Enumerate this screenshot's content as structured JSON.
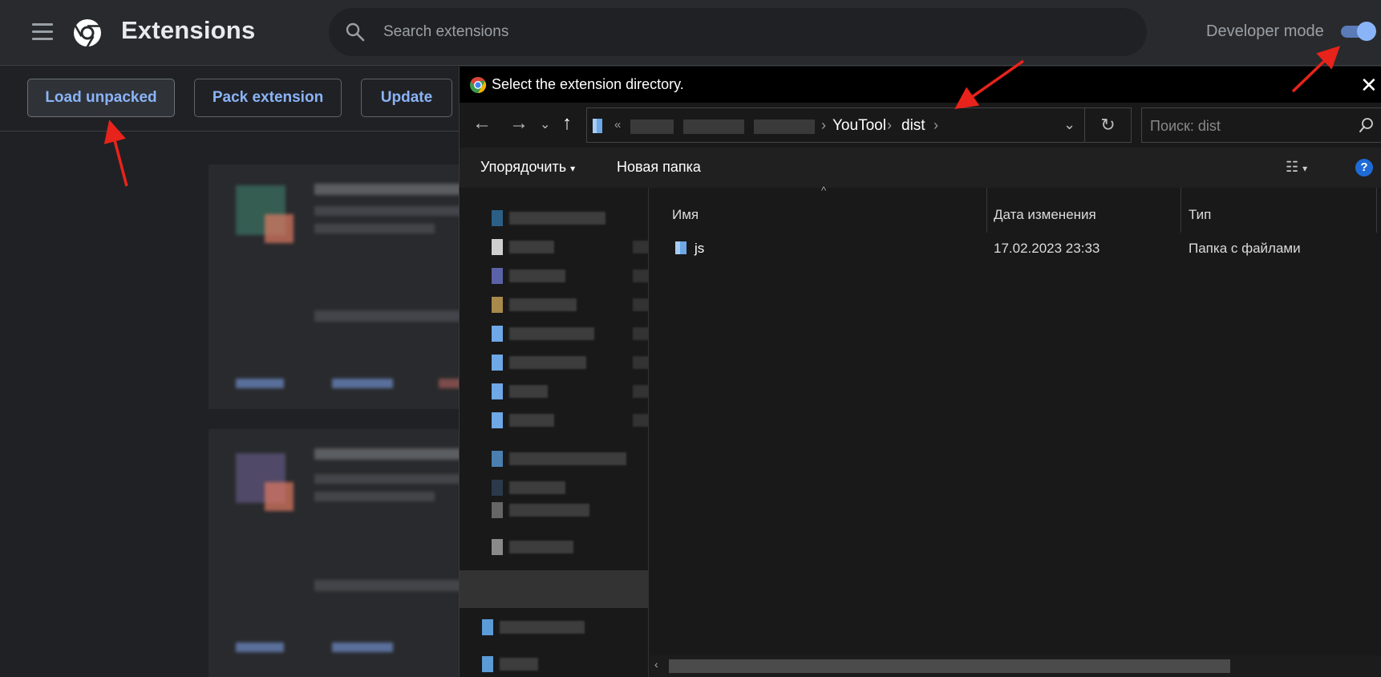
{
  "header": {
    "title": "Extensions",
    "search_placeholder": "Search extensions",
    "developer_mode_label": "Developer mode",
    "developer_mode_on": true
  },
  "toolbar": {
    "load_unpacked": "Load unpacked",
    "pack_extension": "Pack extension",
    "update": "Update"
  },
  "dialog": {
    "title": "Select the extension directory.",
    "close": "✕",
    "path": {
      "overflow": "«",
      "segments": [
        "YouTool",
        "dist"
      ]
    },
    "search_placeholder": "Поиск: dist",
    "commands": {
      "organize": "Упорядочить",
      "new_folder": "Новая папка",
      "help": "?"
    },
    "columns": {
      "name": "Имя",
      "date": "Дата изменения",
      "type": "Тип"
    },
    "files": [
      {
        "name": "js",
        "date": "17.02.2023 23:33",
        "type": "Папка с файлами"
      }
    ]
  },
  "colors": {
    "accent": "#8ab4f8",
    "annotation_arrow": "#e8231b",
    "folder": "#8ab4f8"
  }
}
